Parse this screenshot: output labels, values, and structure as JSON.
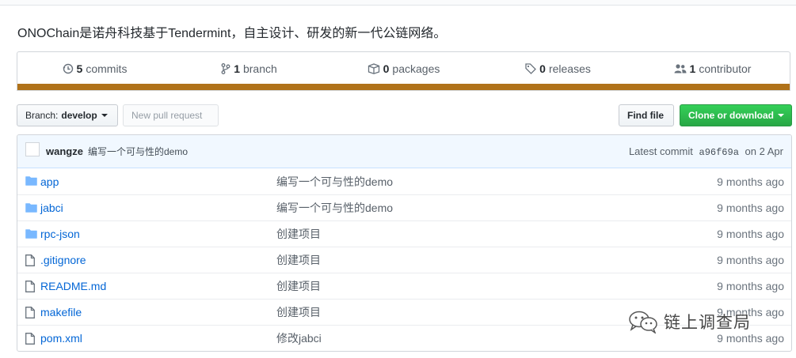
{
  "repo": {
    "description": "ONOChain是诺舟科技基于Tendermint，自主设计、研发的新一代公链网络。"
  },
  "summary": {
    "commits": {
      "num": "5",
      "label": "commits",
      "icon": "history-icon"
    },
    "branches": {
      "num": "1",
      "label": "branch",
      "icon": "branch-icon"
    },
    "packages": {
      "num": "0",
      "label": "packages",
      "icon": "package-icon"
    },
    "releases": {
      "num": "0",
      "label": "releases",
      "icon": "tag-icon"
    },
    "contributors": {
      "num": "1",
      "label": "contributor",
      "icon": "people-icon"
    },
    "language_bar_color": "#b07219"
  },
  "toolbar": {
    "branch_prefix": "Branch:",
    "branch_name": "develop",
    "new_pr": "New pull request",
    "find_file": "Find file",
    "clone": "Clone or download"
  },
  "commit": {
    "author": "wangze",
    "message": "编写一个可与性的demo",
    "latest_prefix": "Latest commit",
    "sha": "a96f69a",
    "on": "on",
    "date": "2 Apr"
  },
  "files": [
    {
      "name": "app",
      "type": "dir",
      "message": "编写一个可与性的demo",
      "age": "9 months ago"
    },
    {
      "name": "jabci",
      "type": "dir",
      "message": "编写一个可与性的demo",
      "age": "9 months ago"
    },
    {
      "name": "rpc-json",
      "type": "dir",
      "message": "创建项目",
      "age": "9 months ago"
    },
    {
      "name": ".gitignore",
      "type": "file",
      "message": "创建项目",
      "age": "9 months ago"
    },
    {
      "name": "README.md",
      "type": "file",
      "message": "创建项目",
      "age": "9 months ago"
    },
    {
      "name": "makefile",
      "type": "file",
      "message": "创建项目",
      "age": "9 months ago"
    },
    {
      "name": "pom.xml",
      "type": "file",
      "message": "修改jabci",
      "age": "9 months ago"
    }
  ],
  "watermark": {
    "text": "链上调查局",
    "icon": "wechat-icon"
  },
  "colors": {
    "link": "#0366d6",
    "primary": "#28a745",
    "commit_bg": "#f1f8ff"
  }
}
